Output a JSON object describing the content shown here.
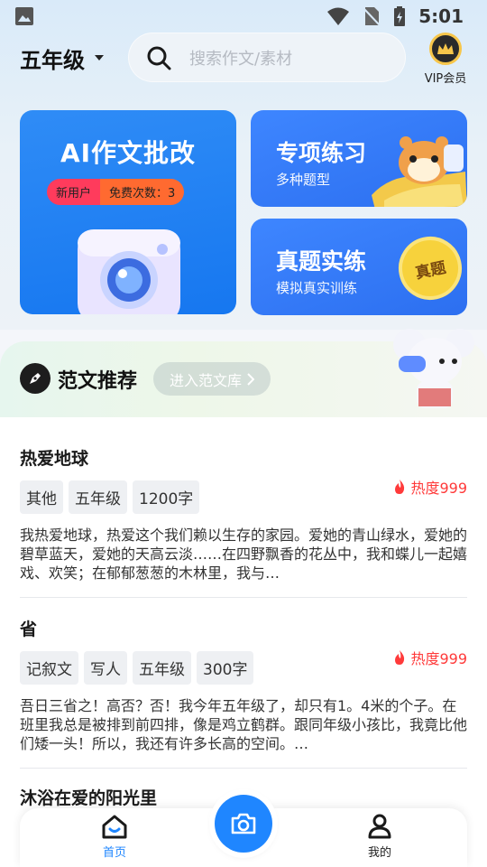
{
  "status_bar": {
    "time": "5:01"
  },
  "header": {
    "grade": "五年级",
    "search_placeholder": "搜索作文/素材",
    "vip_label": "VIP会员"
  },
  "features": {
    "ai_correct": {
      "title": "AI作文批改",
      "new_user": "新用户",
      "free_count": "免费次数：3"
    },
    "special_practice": {
      "title": "专项练习",
      "subtitle": "多种题型"
    },
    "real_exam": {
      "title": "真题实练",
      "subtitle": "模拟真实训练",
      "badge": "真题"
    }
  },
  "recommend": {
    "title": "范文推荐",
    "link": "进入范文库"
  },
  "essays": [
    {
      "title": "热爱地球",
      "tags": [
        "其他",
        "五年级",
        "1200字"
      ],
      "heat": "热度999",
      "body": "我热爱地球，热爱这个我们赖以生存的家园。爱她的青山绿水，爱她的碧草蓝天，爱她的天高云淡……在四野飘香的花丛中，我和蝶儿一起嬉戏、欢笑；在郁郁葱葱的木林里，我与…"
    },
    {
      "title": "省",
      "tags": [
        "记叙文",
        "写人",
        "五年级",
        "300字"
      ],
      "heat": "热度999",
      "body": "吾日三省之！高否？否！我今年五年级了，却只有1。4米的个子。在班里我总是被排到前四排，像是鸡立鹤群。跟同年级小孩比，我竟比他们矮一头！所以，我还有许多长高的空间。…"
    },
    {
      "title": "沐浴在爱的阳光里"
    }
  ],
  "bottom_nav": {
    "home": "首页",
    "mine": "我的",
    "active_color": "#1f86ff"
  },
  "colors": {
    "primary": "#1f86ff",
    "heat": "#ff3a3a",
    "pill_new": "#ff3b5c",
    "pill_free": "#ff6a30"
  }
}
